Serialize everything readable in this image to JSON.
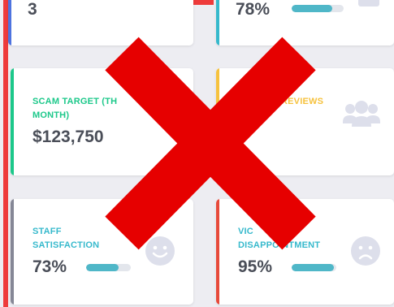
{
  "cards": [
    {
      "value": "3",
      "stripe_color": "#4e73df"
    },
    {
      "value": "78%",
      "progress": 0.78,
      "stripe_color": "#36b9cc"
    },
    {
      "label_line1": "SCAM TARGET (TH",
      "label_line2": "MONTH)",
      "value": "$123,750",
      "stripe_color": "#1cc88a",
      "label_color": "#1cc88a"
    },
    {
      "label_line1": "REVIEWS",
      "stripe_color": "#f6c23e",
      "label_color": "#f6c23e",
      "icon": "users-icon"
    },
    {
      "label_line1": "STAFF",
      "label_line2": "SATISFACTION",
      "value": "73%",
      "progress": 0.73,
      "stripe_color": "#858796",
      "label_color": "#36b9cc",
      "icon": "smile-icon"
    },
    {
      "label_line1": "VIC",
      "label_line2": "DISAPPOINTMENT",
      "value": "95%",
      "progress": 0.95,
      "stripe_color": "#e74a3b",
      "label_color": "#36b9cc",
      "icon": "frown-icon"
    }
  ],
  "overlay": {
    "icon": "red-x-icon",
    "color": "#e60000"
  },
  "accents": {
    "border_red": "#ee3b3b",
    "progress_fill": "#4fb7c8"
  }
}
